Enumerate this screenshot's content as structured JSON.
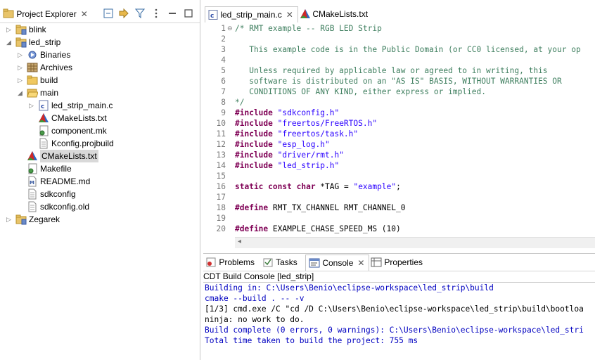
{
  "project_explorer": {
    "title": "Project Explorer",
    "close": "✕",
    "tree": [
      {
        "label": "blink",
        "icon": "project-icon",
        "expanded": false
      },
      {
        "label": "led_strip",
        "icon": "project-icon",
        "expanded": true
      },
      {
        "label": "Binaries",
        "icon": "binaries-icon"
      },
      {
        "label": "Archives",
        "icon": "archives-icon"
      },
      {
        "label": "build",
        "icon": "folder-icon"
      },
      {
        "label": "main",
        "icon": "folder-open-icon"
      },
      {
        "label": "led_strip_main.c",
        "icon": "c-file-icon"
      },
      {
        "label": "CMakeLists.txt",
        "icon": "cmake-icon"
      },
      {
        "label": "component.mk",
        "icon": "makefile-icon"
      },
      {
        "label": "Kconfig.projbuild",
        "icon": "file-icon"
      },
      {
        "label": "CMakeLists.txt",
        "icon": "cmake-icon",
        "selected": true
      },
      {
        "label": "Makefile",
        "icon": "makefile-icon"
      },
      {
        "label": "README.md",
        "icon": "markdown-icon"
      },
      {
        "label": "sdkconfig",
        "icon": "file-icon"
      },
      {
        "label": "sdkconfig.old",
        "icon": "file-icon"
      },
      {
        "label": "Zegarek",
        "icon": "project-icon",
        "expanded": false
      }
    ]
  },
  "editor": {
    "tabs": [
      {
        "label": "led_strip_main.c",
        "close": "✕",
        "active": true
      },
      {
        "label": "CMakeLists.txt",
        "active": false
      }
    ],
    "lines": [
      {
        "n": "1",
        "fold": "⊖",
        "parts": [
          {
            "c": "cmt",
            "t": "/* RMT example -- RGB LED Strip"
          }
        ]
      },
      {
        "n": "2",
        "parts": []
      },
      {
        "n": "3",
        "parts": [
          {
            "c": "cmt",
            "t": "   This example code is in the Public Domain (or CC0 licensed, at your op"
          }
        ]
      },
      {
        "n": "4",
        "parts": []
      },
      {
        "n": "5",
        "parts": [
          {
            "c": "cmt",
            "t": "   Unless required by applicable law or agreed to in writing, this"
          }
        ]
      },
      {
        "n": "6",
        "parts": [
          {
            "c": "cmt",
            "t": "   software is distributed on an \"AS IS\" BASIS, WITHOUT WARRANTIES OR"
          }
        ]
      },
      {
        "n": "7",
        "parts": [
          {
            "c": "cmt",
            "t": "   CONDITIONS OF ANY KIND, either express or implied."
          }
        ]
      },
      {
        "n": "8",
        "parts": [
          {
            "c": "cmt",
            "t": "*/"
          }
        ]
      },
      {
        "n": "9",
        "parts": [
          {
            "c": "pp",
            "t": "#include"
          },
          {
            "c": "",
            "t": " "
          },
          {
            "c": "str",
            "t": "\"sdkconfig.h\""
          }
        ]
      },
      {
        "n": "10",
        "parts": [
          {
            "c": "pp",
            "t": "#include"
          },
          {
            "c": "",
            "t": " "
          },
          {
            "c": "str",
            "t": "\"freertos/FreeRTOS.h\""
          }
        ]
      },
      {
        "n": "11",
        "parts": [
          {
            "c": "pp",
            "t": "#include"
          },
          {
            "c": "",
            "t": " "
          },
          {
            "c": "str",
            "t": "\"freertos/task.h\""
          }
        ]
      },
      {
        "n": "12",
        "parts": [
          {
            "c": "pp",
            "t": "#include"
          },
          {
            "c": "",
            "t": " "
          },
          {
            "c": "str",
            "t": "\"esp_log.h\""
          }
        ]
      },
      {
        "n": "13",
        "parts": [
          {
            "c": "pp",
            "t": "#include"
          },
          {
            "c": "",
            "t": " "
          },
          {
            "c": "str",
            "t": "\"driver/rmt.h\""
          }
        ]
      },
      {
        "n": "14",
        "parts": [
          {
            "c": "pp",
            "t": "#include"
          },
          {
            "c": "",
            "t": " "
          },
          {
            "c": "str",
            "t": "\"led_strip.h\""
          }
        ]
      },
      {
        "n": "15",
        "parts": []
      },
      {
        "n": "16",
        "parts": [
          {
            "c": "kw",
            "t": "static"
          },
          {
            "c": "",
            "t": " "
          },
          {
            "c": "kw",
            "t": "const"
          },
          {
            "c": "",
            "t": " "
          },
          {
            "c": "kw",
            "t": "char"
          },
          {
            "c": "",
            "t": " *TAG = "
          },
          {
            "c": "str",
            "t": "\"example\""
          },
          {
            "c": "",
            "t": ";"
          }
        ]
      },
      {
        "n": "17",
        "parts": []
      },
      {
        "n": "18",
        "parts": [
          {
            "c": "pp",
            "t": "#define"
          },
          {
            "c": "",
            "t": " RMT_TX_CHANNEL RMT_CHANNEL_0"
          }
        ]
      },
      {
        "n": "19",
        "parts": []
      },
      {
        "n": "20",
        "parts": [
          {
            "c": "pp",
            "t": "#define"
          },
          {
            "c": "",
            "t": " EXAMPLE_CHASE_SPEED_MS (10)"
          }
        ]
      }
    ],
    "hscroll_arrow": "◂"
  },
  "bottom": {
    "tabs": [
      {
        "label": "Problems",
        "icon": "problems-icon"
      },
      {
        "label": "Tasks",
        "icon": "tasks-icon"
      },
      {
        "label": "Console",
        "icon": "console-icon",
        "active": true,
        "close": "✕"
      },
      {
        "label": "Properties",
        "icon": "properties-icon"
      }
    ],
    "console_title": "CDT Build Console [led_strip]",
    "lines": [
      {
        "c": "blue",
        "t": "Building in: C:\\Users\\Benio\\eclipse-workspace\\led_strip\\build"
      },
      {
        "c": "blue",
        "t": "cmake --build . -- -v"
      },
      {
        "c": "black",
        "t": "[1/3] cmd.exe /C \"cd /D C:\\Users\\Benio\\eclipse-workspace\\led_strip\\build\\bootloa"
      },
      {
        "c": "black",
        "t": "ninja: no work to do."
      },
      {
        "c": "blue",
        "t": "Build complete (0 errors, 0 warnings): C:\\Users\\Benio\\eclipse-workspace\\led_stri"
      },
      {
        "c": "blue",
        "t": "Total time taken to build the project: 755 ms"
      }
    ]
  }
}
